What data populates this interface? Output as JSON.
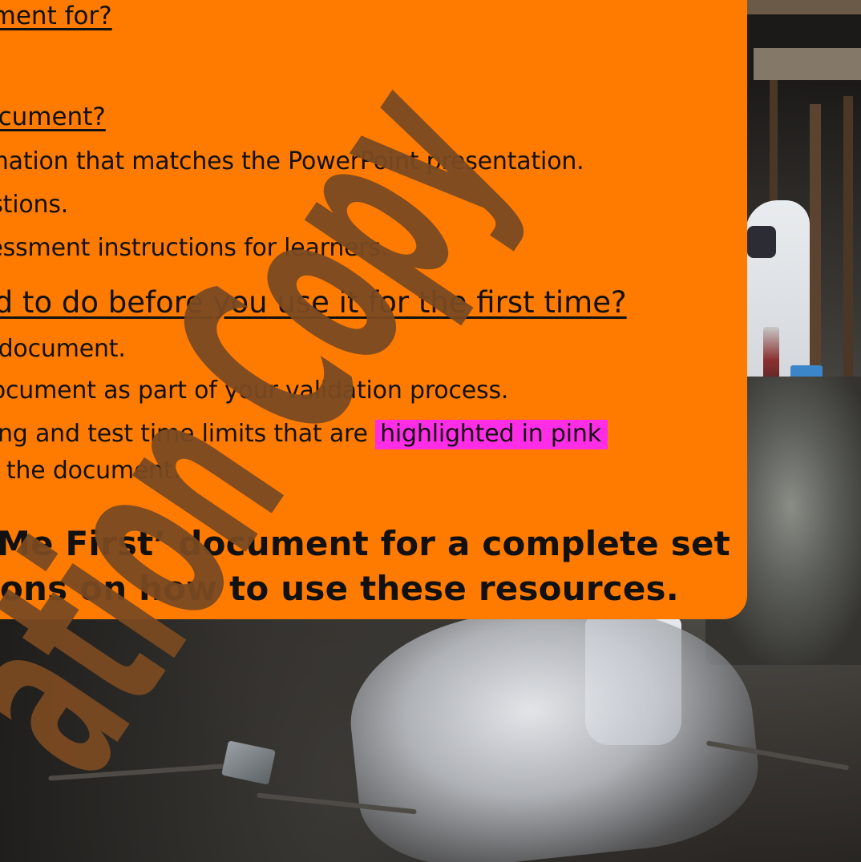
{
  "slide": {
    "q1_heading": "ument for?",
    "q2_heading": "locument?",
    "q2_items": [
      "rmation that matches the PowerPoint presentation.",
      "estions.",
      "sessment instructions for learners."
    ],
    "q3_heading": "ed to do before you use it for the first time?",
    "q3_items": [
      "e document.",
      " document as part of your validation process.",
      "ding and test time limits that are ",
      "of the document."
    ],
    "highlight_text": "highlighted in pink",
    "closing_line_1": "Me First’ document for a complete set",
    "closing_line_2": "ons on how to use these resources.",
    "panel_color": "#ff7b00",
    "highlight_color": "#ff2ee6"
  },
  "watermark": {
    "text": "ation Copy",
    "color": "#7a4a22"
  }
}
